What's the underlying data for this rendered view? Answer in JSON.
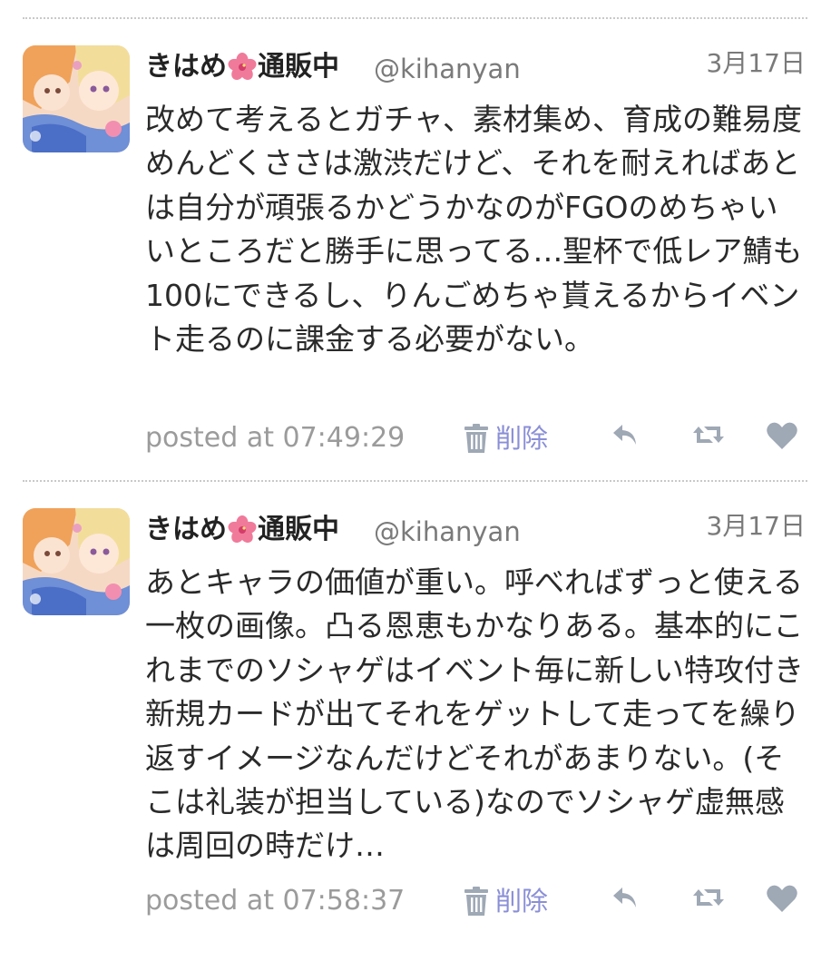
{
  "colors": {
    "divider": "#c9c9c9",
    "muted_text": "#7a7a7a",
    "body_text": "#2a2a2a",
    "delete_accent": "#8a8fd6",
    "icon_gray": "#9fa8b5"
  },
  "tweets": [
    {
      "display_name_before": "きはめ",
      "display_name_icon": "hibiscus-flower-icon",
      "display_name_after": "通販中",
      "screen_name": "@kihanyan",
      "date": "3月17日",
      "text": "改めて考えるとガチャ、素材集め、育成の難易度めんどくささは激渋だけど、それを耐えればあとは自分が頑張るかどうかなのがFGOのめちゃいいところだと勝手に思ってる…聖杯で低レア鯖も100にできるし、りんごめちゃ貰えるからイベント走るのに課金する必要がない。",
      "posted": "posted at 07:49:29",
      "delete_label": "削除",
      "icons": [
        "trash-icon",
        "reply-icon",
        "retweet-icon",
        "heart-icon"
      ]
    },
    {
      "display_name_before": "きはめ",
      "display_name_icon": "hibiscus-flower-icon",
      "display_name_after": "通販中",
      "screen_name": "@kihanyan",
      "date": "3月17日",
      "text": "あとキャラの価値が重い。呼べればずっと使える一枚の画像。凸る恩恵もかなりある。基本的にこれまでのソシャゲはイベント毎に新しい特攻付き新規カードが出てそれをゲットして走ってを繰り返すイメージなんだけどそれがあまりない。(そこは礼装が担当している)なのでソシャゲ虚無感は周回の時だけ…",
      "posted": "posted at 07:58:37",
      "delete_label": "削除",
      "icons": [
        "trash-icon",
        "reply-icon",
        "retweet-icon",
        "heart-icon"
      ]
    }
  ]
}
